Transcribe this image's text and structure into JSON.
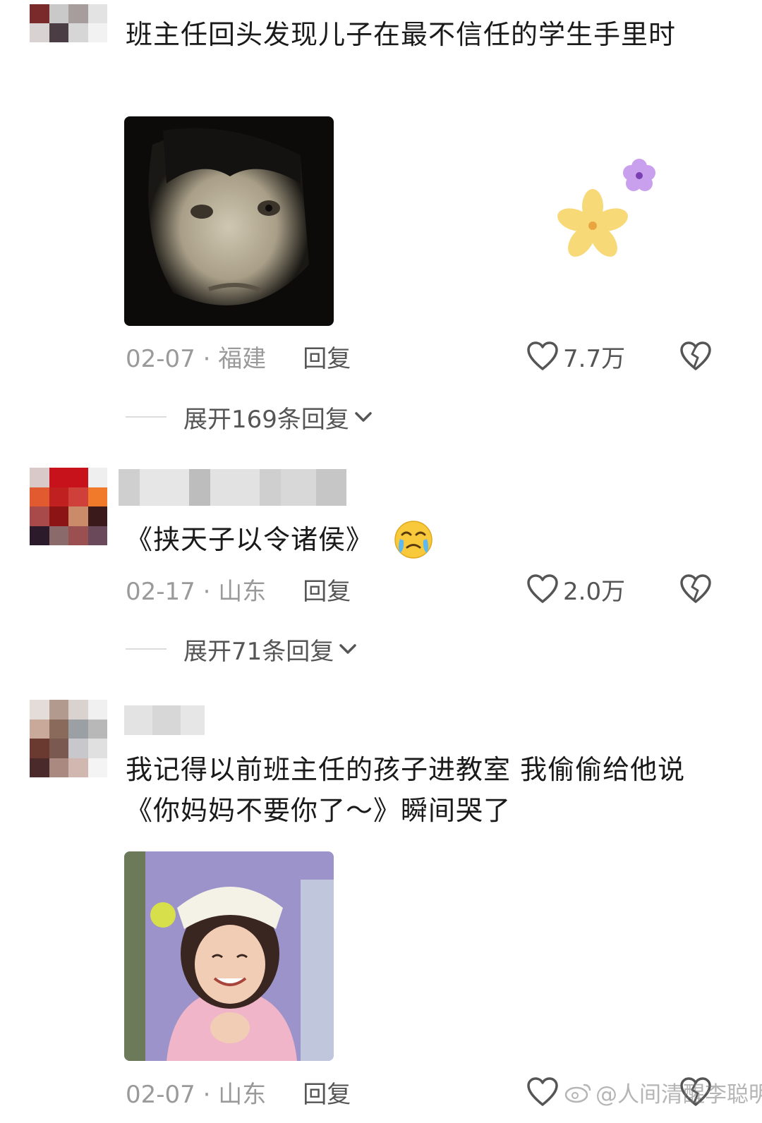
{
  "comments": [
    {
      "text": "班主任回头发现儿子在最不信任的学生手里时",
      "date_location": "02-07 · 福建",
      "reply_label": "回复",
      "likes": "7.7万",
      "expand_label": "展开169条回复"
    },
    {
      "text": "《挟天子以令诸侯》",
      "emoji": "crying-face-emoji",
      "date_location": "02-17 · 山东",
      "reply_label": "回复",
      "likes": "2.0万",
      "expand_label": "展开71条回复"
    },
    {
      "text": "我记得以前班主任的孩子进教室 我偷偷给他说《你妈妈不要你了～》瞬间哭了",
      "date_location": "02-07 · 山东",
      "reply_label": "回复"
    }
  ],
  "watermark": "@人间清醒李聪明",
  "icons": {
    "like": "heart-outline-icon",
    "dislike": "broken-heart-icon",
    "expand": "chevron-down-icon",
    "weibo": "weibo-logo-icon"
  },
  "colors": {
    "text": "#1a1a1a",
    "meta": "#9a9a9a",
    "secondary": "#555555"
  }
}
